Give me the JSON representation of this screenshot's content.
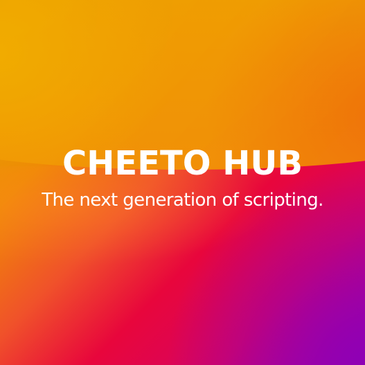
{
  "brand": {
    "title": "CHEETO HUB",
    "tagline": "The next generation of scripting."
  },
  "colors": {
    "gradient_top_left": "#c9ad00",
    "gradient_orange": "#f08a05",
    "gradient_red": "#e8063c",
    "gradient_magenta": "#d8045f",
    "gradient_bottom_right": "#8f00b5",
    "text": "#ffffff"
  }
}
